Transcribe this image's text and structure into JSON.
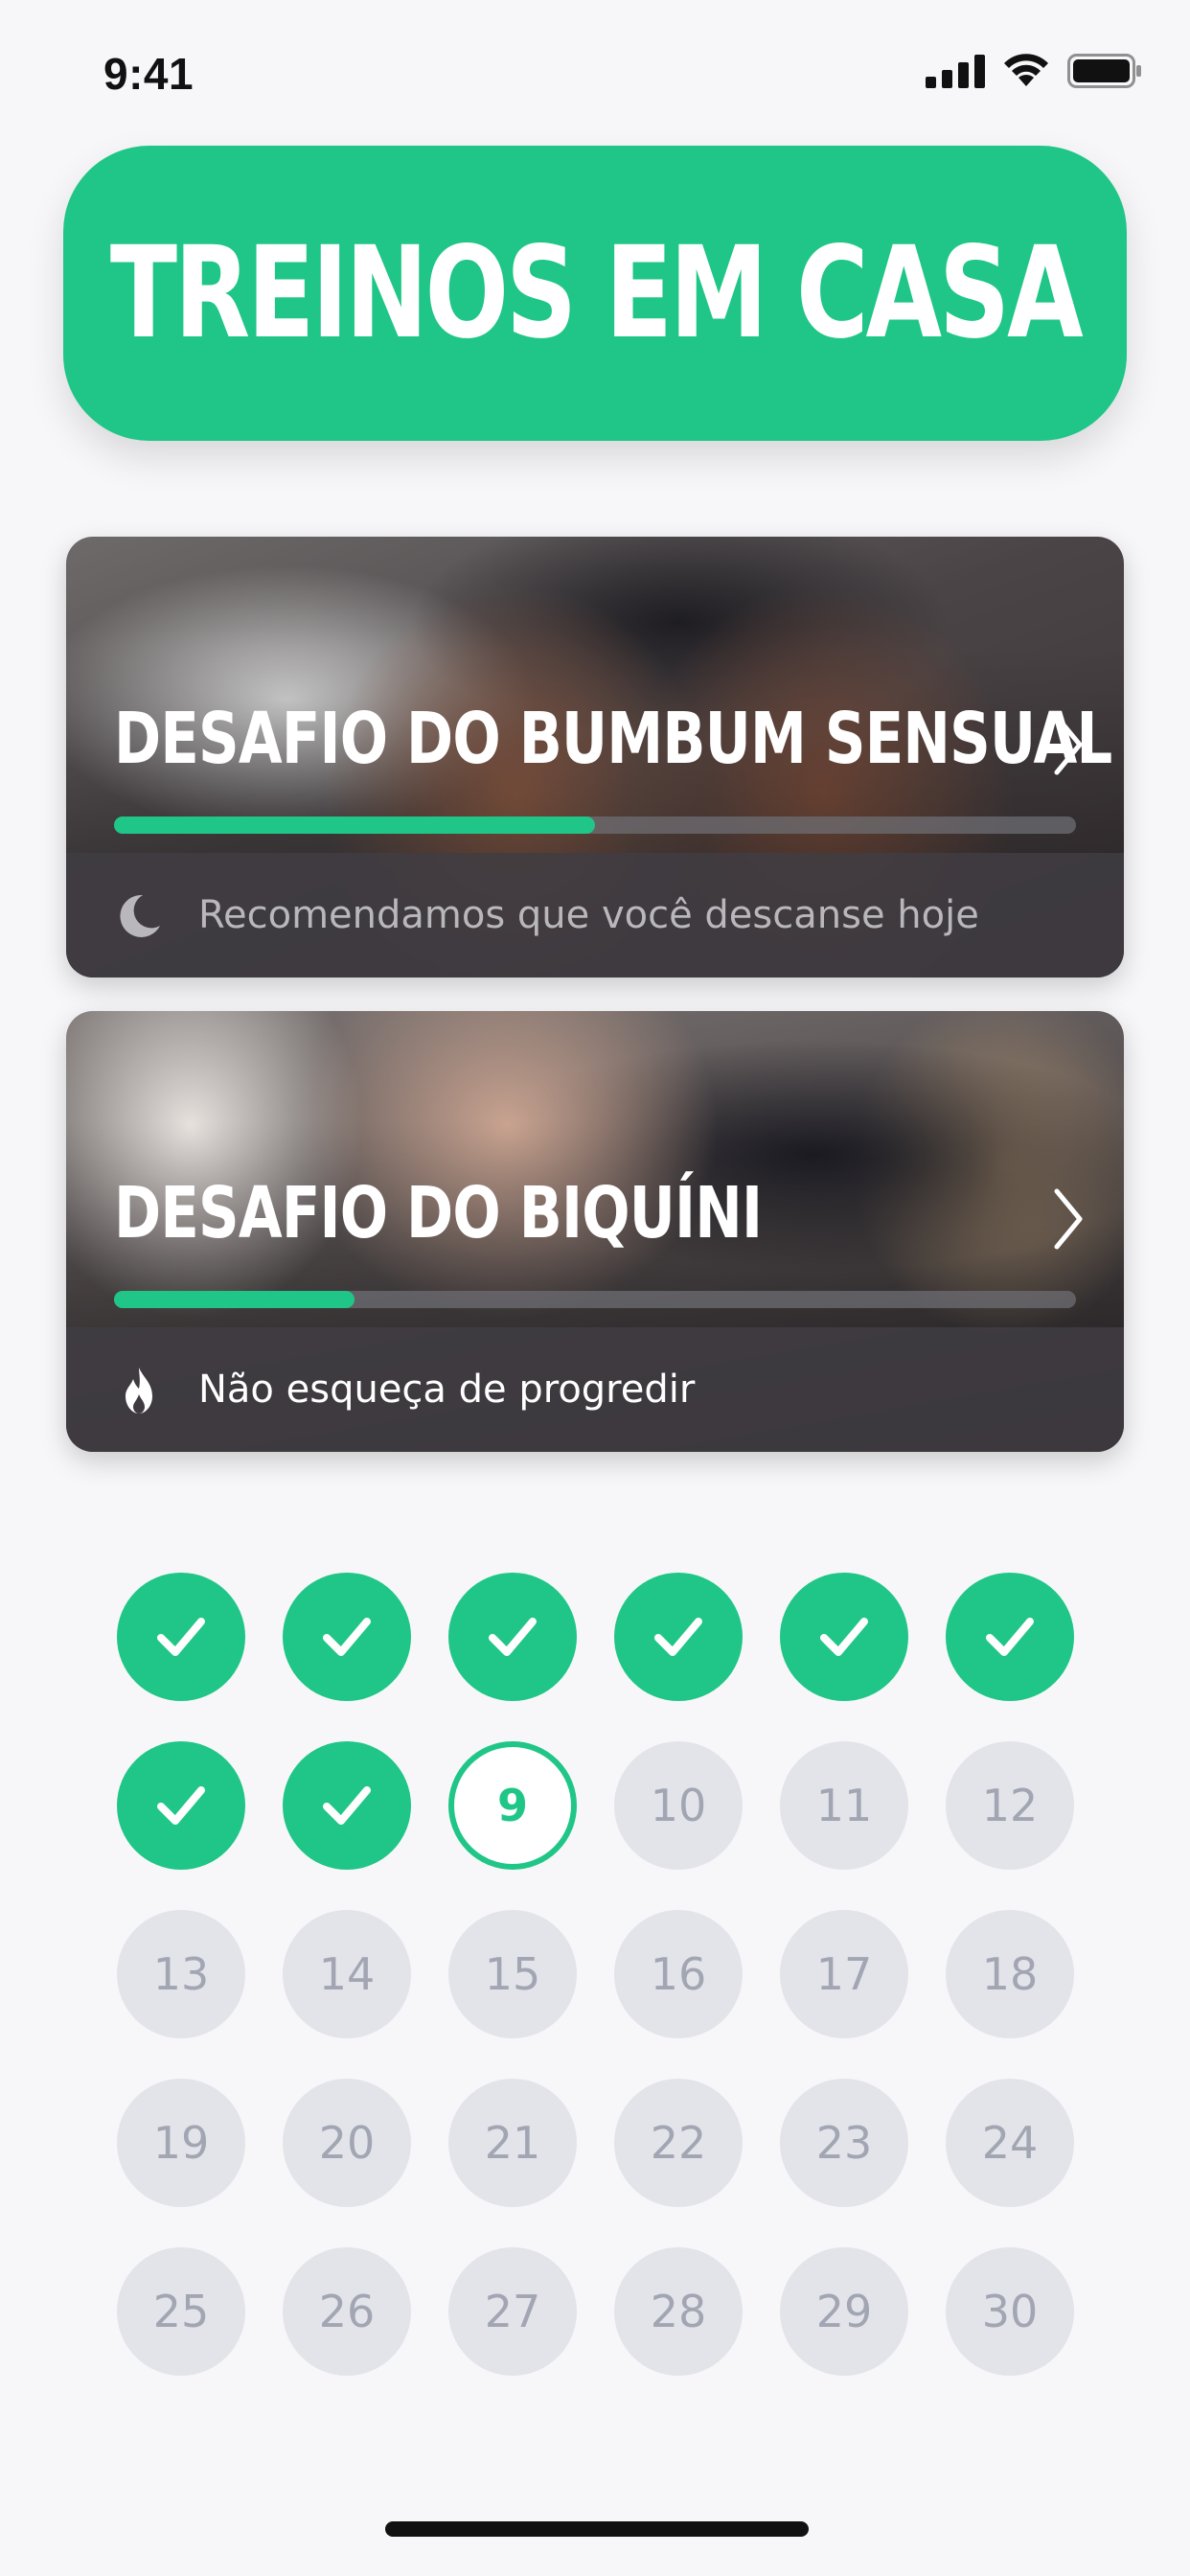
{
  "status_bar": {
    "time": "9:41",
    "signal_icon": "cellular-signal-icon",
    "wifi_icon": "wifi-icon",
    "battery_icon": "battery-icon"
  },
  "header": {
    "title": "TREINOS EM CASA"
  },
  "challenges": [
    {
      "title": "DESAFIO DO BUMBUM SENSUAL",
      "progress": 0.5,
      "footer_icon": "moon-icon",
      "footer_text": "Recomendamos que você descanse hoje"
    },
    {
      "title": "DESAFIO DO BIQUÍNI",
      "progress": 0.25,
      "footer_icon": "flame-icon",
      "footer_text": "Não esqueça de progredir"
    }
  ],
  "days": {
    "completed": [
      1,
      2,
      3,
      4,
      5,
      6,
      7,
      8
    ],
    "current": "9",
    "upcoming": [
      "10",
      "11",
      "12",
      "13",
      "14",
      "15",
      "16",
      "17",
      "18",
      "19",
      "20",
      "21",
      "22",
      "23",
      "24",
      "25",
      "26",
      "27",
      "28",
      "29",
      "30"
    ]
  },
  "colors": {
    "accent": "#1fc687",
    "upcoming_day_bg": "#e3e4ea",
    "upcoming_day_text": "#a2a6b3",
    "background": "#f7f7f9"
  }
}
